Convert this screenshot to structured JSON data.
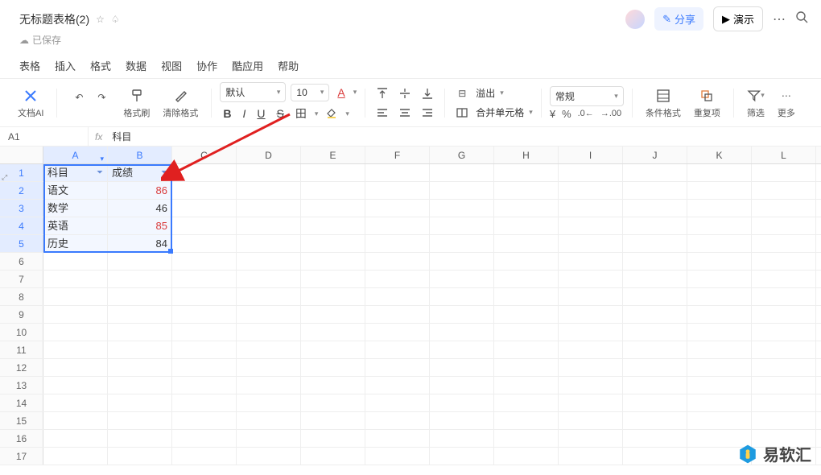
{
  "title": "无标题表格(2)",
  "saved_label": "已保存",
  "share_label": "分享",
  "demo_label": "演示",
  "menu": [
    "表格",
    "插入",
    "格式",
    "数据",
    "视图",
    "协作",
    "酷应用",
    "帮助"
  ],
  "toolbar": {
    "docai": "文档AI",
    "redo_undo": "",
    "format_painter": "格式刷",
    "clear_format": "清除格式",
    "font_name": "默认",
    "font_size": "10",
    "overflow": "溢出",
    "merge": "合并单元格",
    "number_format": "常规",
    "cond_format": "条件格式",
    "repeat": "重复项",
    "filter": "筛选",
    "more": "更多"
  },
  "namebox": "A1",
  "formula": "科目",
  "columns": [
    "A",
    "B",
    "C",
    "D",
    "E",
    "F",
    "G",
    "H",
    "I",
    "J",
    "K",
    "L"
  ],
  "rows": [
    1,
    2,
    3,
    4,
    5,
    6,
    7,
    8,
    9,
    10,
    11,
    12,
    13,
    14,
    15,
    16,
    17
  ],
  "headers": {
    "c0": "科目",
    "c1": "成绩"
  },
  "data": [
    {
      "subject": "语文",
      "score": "86",
      "red": true
    },
    {
      "subject": "数学",
      "score": "46",
      "red": false
    },
    {
      "subject": "英语",
      "score": "85",
      "red": true
    },
    {
      "subject": "历史",
      "score": "84",
      "red": false
    }
  ],
  "watermark": "易软汇"
}
